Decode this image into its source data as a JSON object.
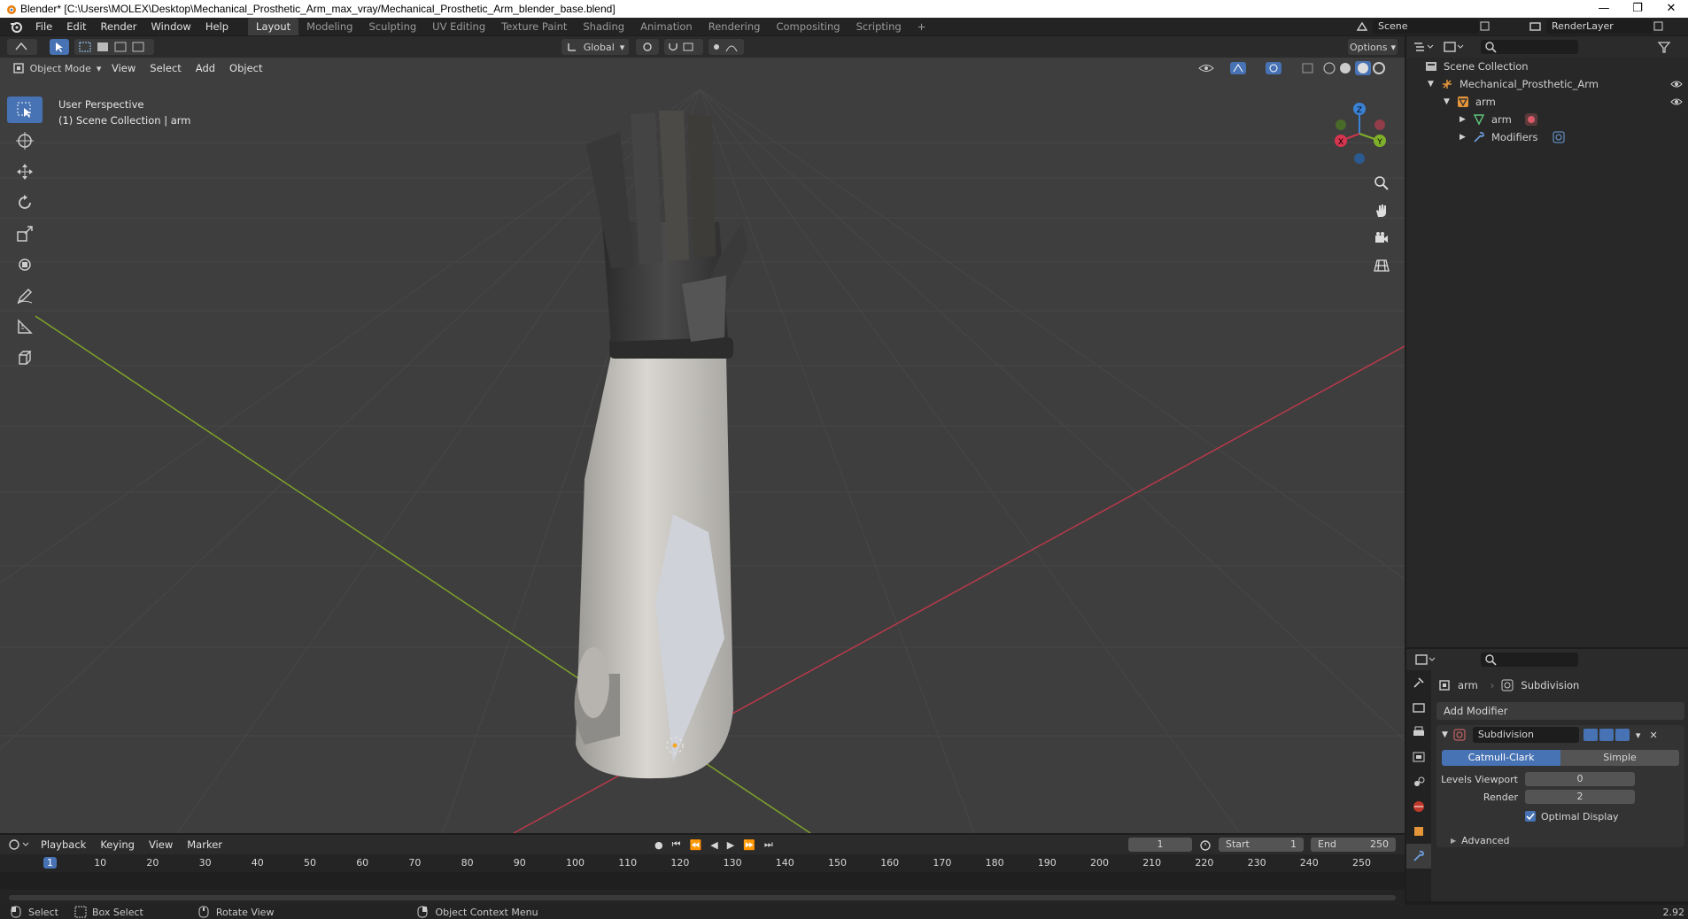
{
  "window": {
    "title": "Blender* [C:\\Users\\MOLEX\\Desktop\\Mechanical_Prosthetic_Arm_max_vray/Mechanical_Prosthetic_Arm_blender_base.blend]",
    "min": "—",
    "max": "❐",
    "close": "✕"
  },
  "menu": [
    "File",
    "Edit",
    "Render",
    "Window",
    "Help"
  ],
  "workspaces": [
    "Layout",
    "Modeling",
    "Sculpting",
    "UV Editing",
    "Texture Paint",
    "Shading",
    "Animation",
    "Rendering",
    "Compositing",
    "Scripting"
  ],
  "active_workspace": "Layout",
  "add_workspace": "+",
  "scene": "Scene",
  "render_layer": "RenderLayer",
  "viewport": {
    "transform_orientation": "Global",
    "options": "Options",
    "mode": "Object Mode",
    "menus": [
      "View",
      "Select",
      "Add",
      "Object"
    ],
    "perspective_label": "User Perspective",
    "collection_label": "(1) Scene Collection | arm"
  },
  "gizmo": {
    "x": "X",
    "y": "Y",
    "z": "Z"
  },
  "outliner": {
    "root": "Scene Collection",
    "items": [
      {
        "label": "Mechanical_Prosthetic_Arm",
        "depth": 1
      },
      {
        "label": "arm",
        "depth": 2
      },
      {
        "label": "arm",
        "depth": 3
      },
      {
        "label": "Modifiers",
        "depth": 3
      }
    ]
  },
  "properties": {
    "object": "arm",
    "modifier_crumb": "Subdivision",
    "add_modifier": "Add Modifier",
    "modifier_name": "Subdivision",
    "type_options": [
      "Catmull-Clark",
      "Simple"
    ],
    "type_selected": "Catmull-Clark",
    "levels_viewport_label": "Levels Viewport",
    "levels_viewport": "0",
    "render_label": "Render",
    "render": "2",
    "optimal_display_label": "Optimal Display",
    "optimal_display": true,
    "advanced_label": "Advanced"
  },
  "timeline": {
    "menus": [
      "Playback",
      "Keying",
      "View",
      "Marker"
    ],
    "current_frame": "1",
    "start_label": "Start",
    "start": "1",
    "end_label": "End",
    "end": "250",
    "ruler_marks": [
      "1",
      "10",
      "20",
      "30",
      "40",
      "50",
      "60",
      "70",
      "80",
      "90",
      "100",
      "110",
      "120",
      "130",
      "140",
      "150",
      "160",
      "170",
      "180",
      "190",
      "200",
      "210",
      "220",
      "230",
      "240",
      "250"
    ]
  },
  "status": {
    "select": "Select",
    "box_select": "Box Select",
    "rotate_view": "Rotate View",
    "context_menu": "Object Context Menu",
    "version": "2.92"
  }
}
